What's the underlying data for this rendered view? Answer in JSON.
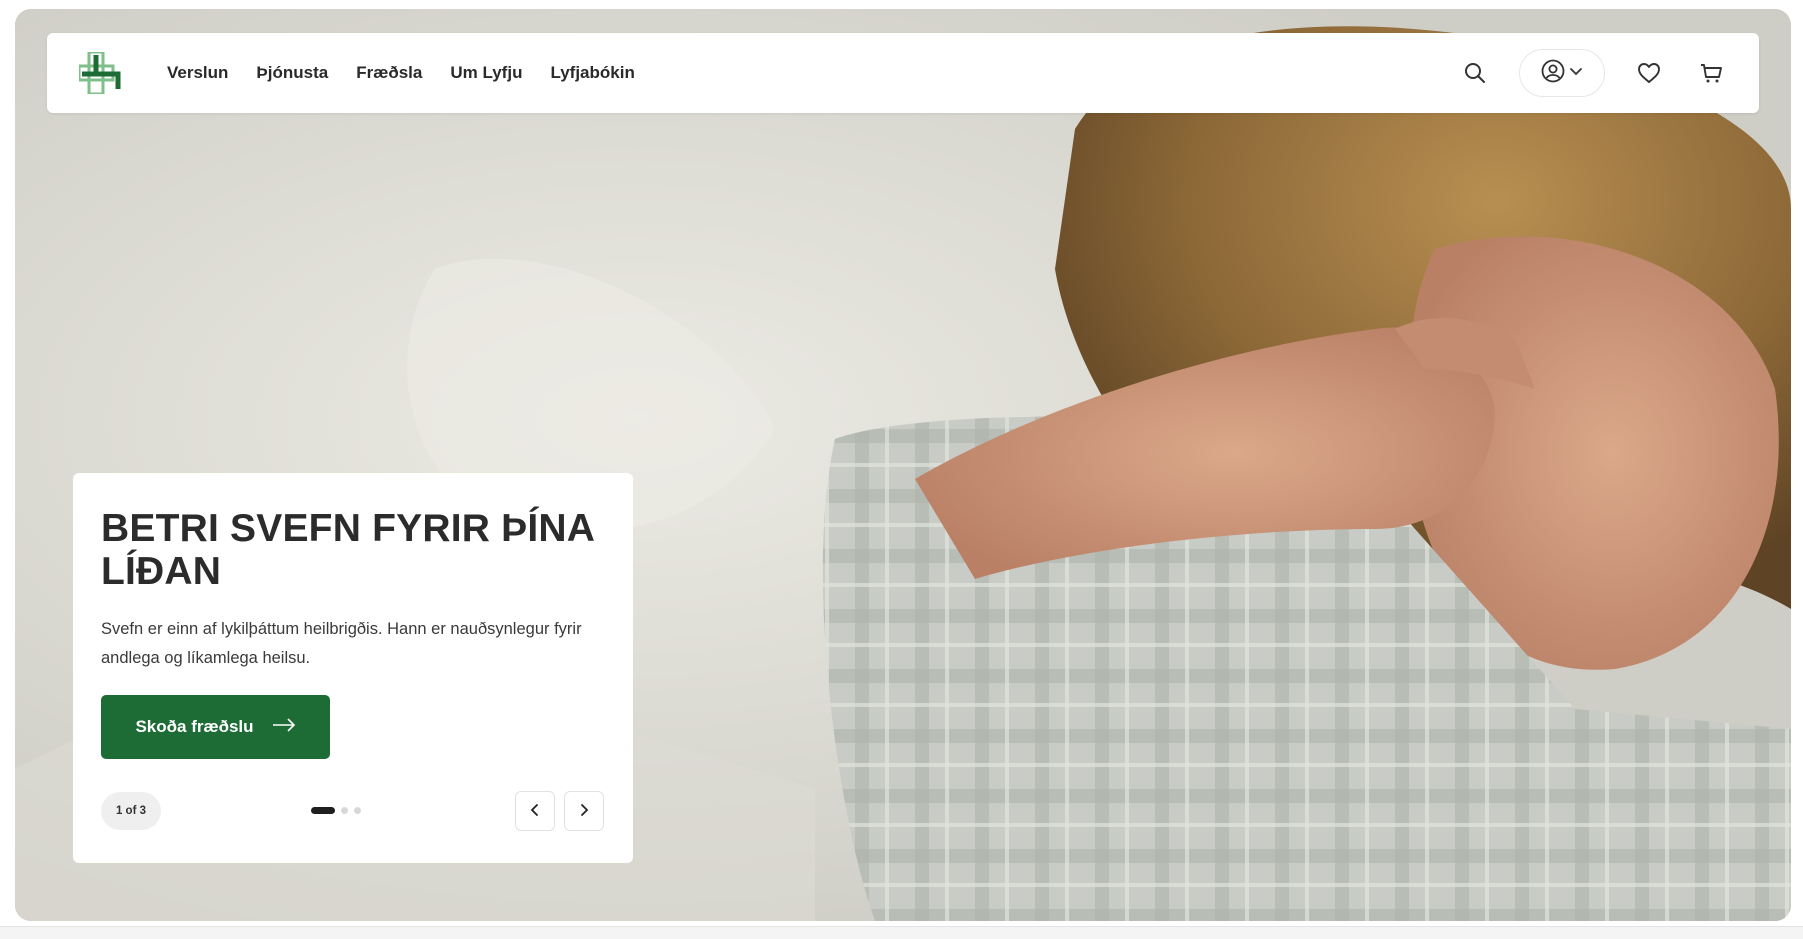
{
  "nav": {
    "logo_icon": "lyfja-cross-logo",
    "links": [
      "Verslun",
      "Þjónusta",
      "Fræðsla",
      "Um Lyfju",
      "Lyfjabókin"
    ],
    "icons": {
      "search": "search-icon",
      "account": "user-circle-icon",
      "account_chevron": "chevron-down-icon",
      "wishlist": "heart-icon",
      "cart": "cart-icon"
    }
  },
  "hero": {
    "title": "BETRI SVEFN FYRIR ÞÍNA LÍÐAN",
    "text": "Svefn er einn af lykilþáttum heilbrigðis. Hann er nauðsynlegur fyrir andlega og líkamlega heilsu.",
    "cta_label": "Skoða fræðslu",
    "cta_icon": "arrow-right-icon",
    "slide_counter": "1 of 3",
    "slide_current": 1,
    "slide_total": 3,
    "prev_icon": "chevron-left-icon",
    "next_icon": "chevron-right-icon"
  },
  "colors": {
    "brand_green": "#1d6b35",
    "text_dark": "#2b2b2b",
    "background": "#d6d5cd"
  }
}
